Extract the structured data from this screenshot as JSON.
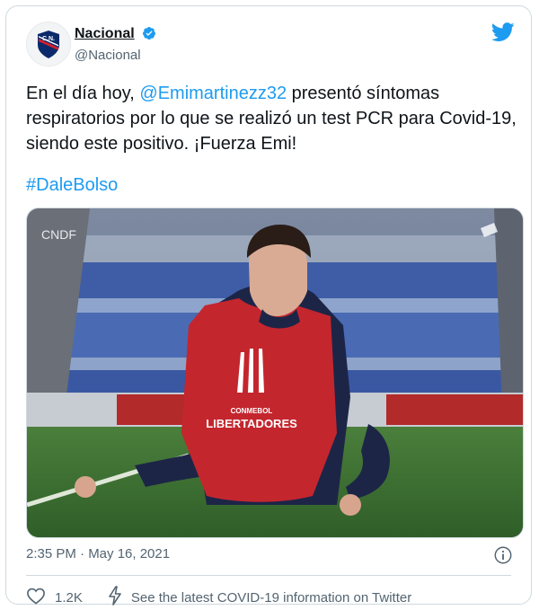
{
  "author": {
    "display_name": "Nacional",
    "handle": "@Nacional",
    "avatar_icon": "club-crest-icon",
    "verified": true
  },
  "tweet": {
    "text_before": "En el día hoy, ",
    "mention": "@Emimartinezz32",
    "text_after": " presentó síntomas respiratorios por lo que se realizó un test PCR para Covid-19, siendo este positivo. ¡Fuerza Emi!",
    "hashtag": "#DaleBolso"
  },
  "media": {
    "watermark": "CNDF",
    "bib_brand": "CONMEBOL",
    "bib_text": "LIBERTADORES"
  },
  "meta": {
    "timestamp": "2:35 PM · May 16, 2021",
    "likes": "1.2K",
    "covid_link": "See the latest COVID-19 information on Twitter"
  },
  "colors": {
    "twitter_blue": "#1d9bf0",
    "text": "#0f1419",
    "muted": "#536471",
    "border": "#cfd9de"
  }
}
